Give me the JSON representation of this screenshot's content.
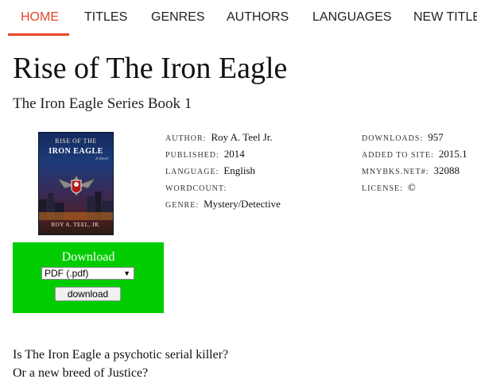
{
  "nav": {
    "items": [
      {
        "label": "HOME"
      },
      {
        "label": "TITLES"
      },
      {
        "label": "GENRES"
      },
      {
        "label": "AUTHORS"
      },
      {
        "label": "LANGUAGES"
      },
      {
        "label": "NEW TITLES"
      }
    ],
    "active_color": "#e8472a"
  },
  "book": {
    "title": "Rise of The Iron Eagle",
    "series": "The Iron Eagle Series Book 1",
    "cover": {
      "line1": "RISE OF THE",
      "line2": "IRON EAGLE",
      "tag": "A Novel",
      "author": "ROY A. TEEL, JR."
    }
  },
  "meta_left": {
    "author_label": "AUTHOR:",
    "author": "Roy A. Teel Jr.",
    "published_label": "PUBLISHED:",
    "published": "2014",
    "language_label": "LANGUAGE:",
    "language": "English",
    "wordcount_label": "WORDCOUNT:",
    "wordcount": "",
    "genre_label": "GENRE:",
    "genre": "Mystery/Detective"
  },
  "meta_right": {
    "downloads_label": "DOWNLOADS:",
    "downloads": "957",
    "added_label": "ADDED TO SITE:",
    "added": "2015.1",
    "id_label": "MNYBKS.NET#:",
    "id": "32088",
    "license_label": "LICENSE:",
    "license": "©"
  },
  "download": {
    "heading": "Download",
    "format_selected": "PDF (.pdf)",
    "button_label": "download",
    "bg_color": "#00cc00"
  },
  "description": {
    "line1": "Is The Iron Eagle a psychotic serial killer?",
    "line2": "Or a new breed of Justice?"
  }
}
